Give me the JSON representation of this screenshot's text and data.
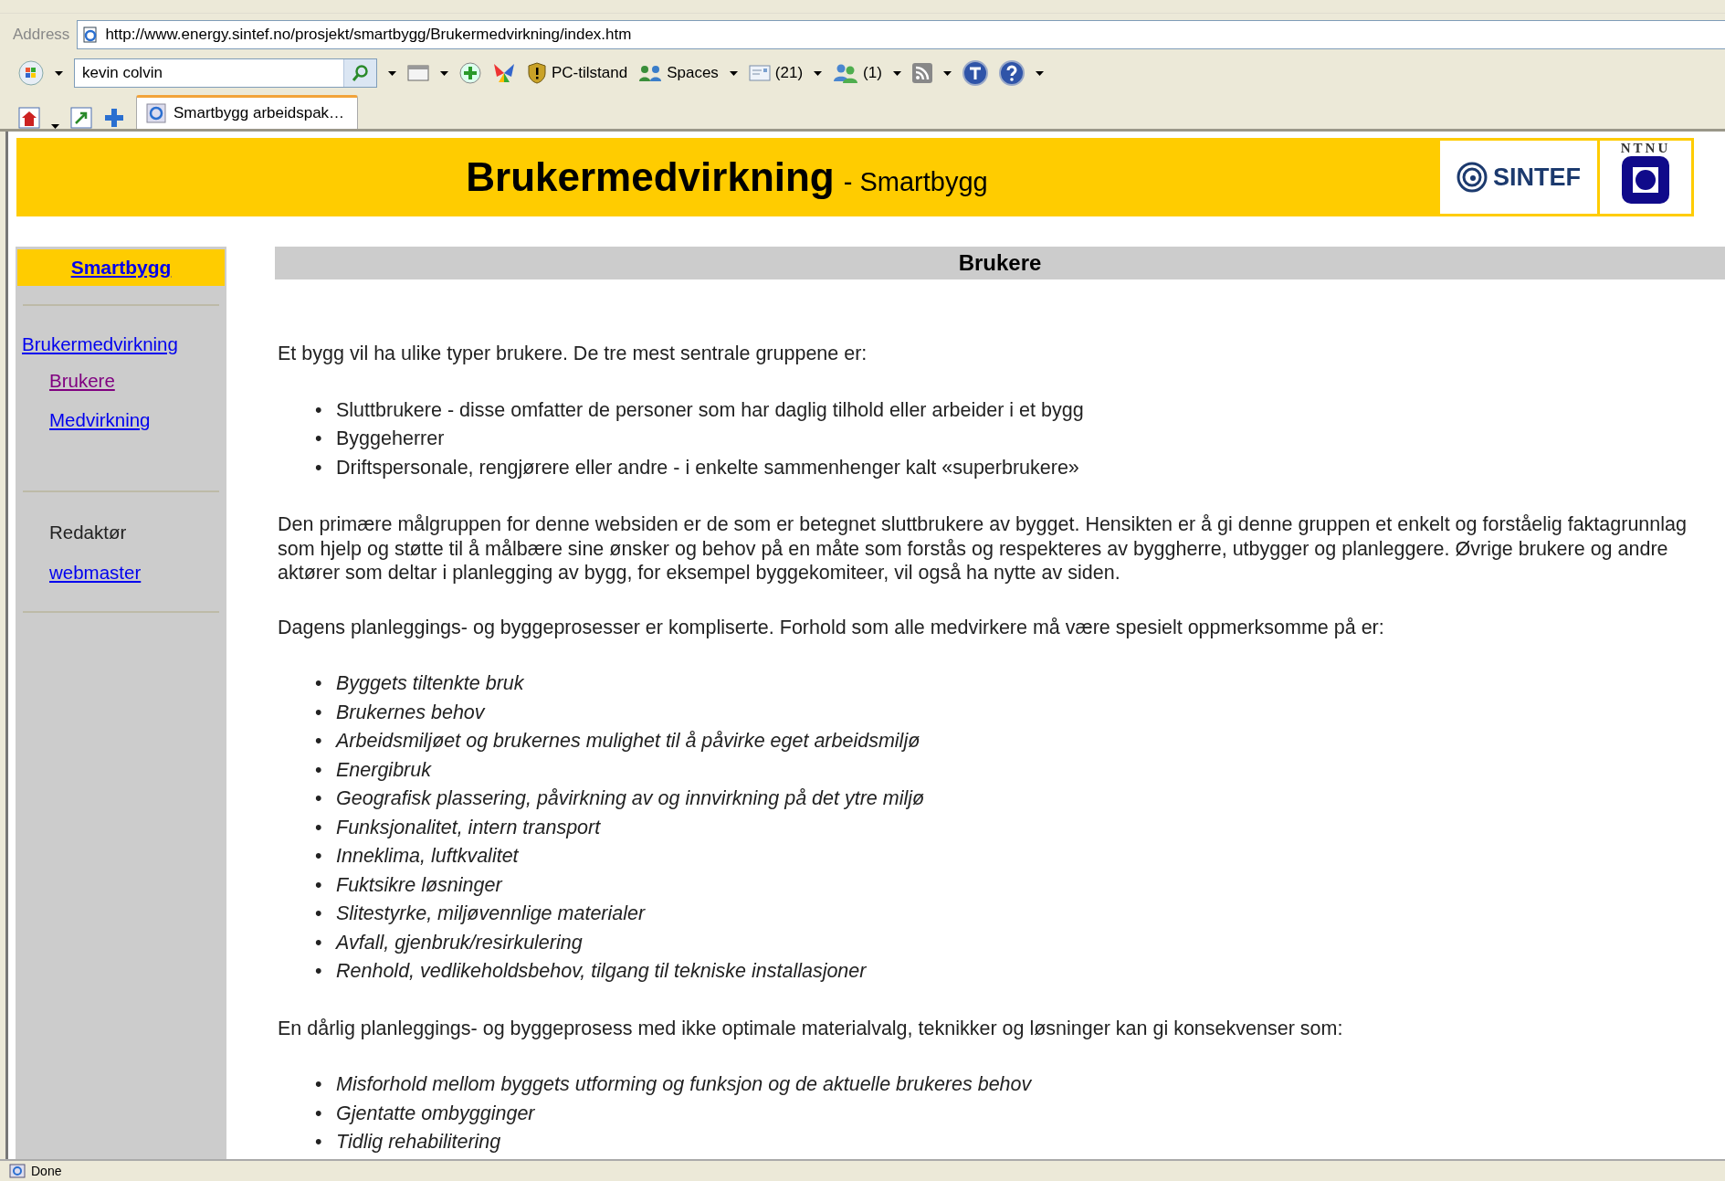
{
  "browser": {
    "address_label": "Address",
    "url": "http://www.energy.sintef.no/prosjekt/smartbygg/Brukermedvirkning/index.htm",
    "search": {
      "value": "kevin colvin"
    },
    "toolbar": [
      {
        "kind": "shield",
        "label": "PC-tilstand"
      },
      {
        "kind": "people",
        "label": "Spaces"
      },
      {
        "kind": "mail",
        "label": "(21)"
      },
      {
        "kind": "contacts",
        "label": "(1)"
      }
    ],
    "tabs": [
      {
        "label": "Smartbygg arbeidspak…",
        "selected": true
      }
    ],
    "status_bar": "Done"
  },
  "header": {
    "title": "Brukermedvirkning",
    "subtitle": "- Smartbygg",
    "logos": [
      "SINTEF",
      "NTNU"
    ]
  },
  "sidebar": {
    "home": "Smartbygg",
    "items": [
      {
        "label": "Brukermedvirkning",
        "visited": false,
        "children": [
          {
            "label": "Brukere",
            "visited": true
          },
          {
            "label": "Medvirkning",
            "visited": false
          }
        ]
      }
    ],
    "editor_label": "Redaktør",
    "editor_link": "webmaster"
  },
  "content": {
    "heading": "Brukere",
    "blocks": [
      {
        "kind": "paragraph",
        "text": "Et bygg vil ha ulike typer brukere. De tre mest sentrale gruppene er:"
      },
      {
        "kind": "list",
        "italic": false,
        "bullet": "•",
        "items": [
          "Sluttbrukere - disse omfatter de personer som har daglig tilhold eller arbeider i et bygg",
          "Byggeherrer",
          "Driftspersonale, rengjørere eller andre - i enkelte sammenhenger kalt «superbrukere»"
        ]
      },
      {
        "kind": "paragraph",
        "text": "Den primære målgruppen for denne websiden er de som er betegnet sluttbrukere av bygget. Hensikten er å gi denne gruppen et enkelt og forståelig faktagrunnlag som hjelp og støtte til å målbære sine ønsker og behov på en måte som forstås og respekteres av byggherre, utbygger og planleggere. Øvrige brukere og andre aktører som deltar i planlegging av bygg, for eksempel byggekomiteer, vil også ha nytte av siden."
      },
      {
        "kind": "paragraph",
        "text": "Dagens planleggings- og byggeprosesser er kompliserte. Forhold som alle medvirkere må være spesielt oppmerksomme på er:"
      },
      {
        "kind": "list",
        "italic": true,
        "bullet": "•",
        "items": [
          "Byggets tiltenkte bruk",
          "Brukernes behov",
          "Arbeidsmiljøet og brukernes mulighet til å påvirke eget arbeidsmiljø",
          "Energibruk",
          "Geografisk plassering, påvirkning av og innvirkning på det ytre miljø",
          "Funksjonalitet, intern transport",
          "Inneklima, luftkvalitet",
          "Fuktsikre løsninger",
          "Slitestyrke, miljøvennlige materialer",
          "Avfall, gjenbruk/resirkulering",
          "Renhold, vedlikeholdsbehov, tilgang til tekniske installasjoner"
        ]
      },
      {
        "kind": "paragraph",
        "text": "En dårlig planleggings- og byggeprosess med ikke optimale materialvalg, teknikker og løsninger kan gi konsekvenser som:"
      },
      {
        "kind": "list",
        "italic": true,
        "bullet": "•",
        "items": [
          "Misforhold mellom byggets utforming og funksjon og de aktuelle brukeres behov",
          "Gjentatte ombygginger",
          "Tidlig rehabilitering"
        ]
      }
    ]
  }
}
